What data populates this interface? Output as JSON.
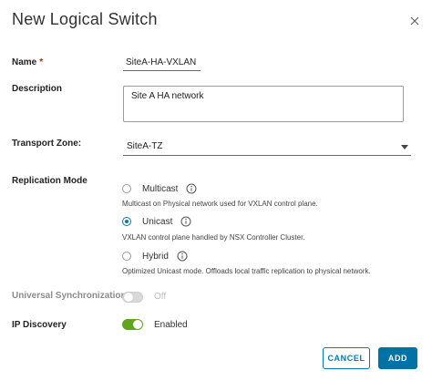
{
  "dialog": {
    "title": "New Logical Switch"
  },
  "fields": {
    "name": {
      "label": "Name",
      "required_mark": "*",
      "value": "SiteA-HA-VXLAN"
    },
    "description": {
      "label": "Description",
      "value": "Site A HA network"
    },
    "transport_zone": {
      "label": "Transport Zone:",
      "selected": "SiteA-TZ"
    },
    "replication_mode": {
      "label": "Replication Mode",
      "selected": "Unicast",
      "options": [
        {
          "label": "Multicast",
          "description": "Multicast on Physical network used for VXLAN control plane."
        },
        {
          "label": "Unicast",
          "description": "VXLAN control plane handled by NSX Controller Cluster."
        },
        {
          "label": "Hybrid",
          "description": "Optimized Unicast mode. Offloads local traffic replication to physical network."
        }
      ]
    },
    "universal_sync": {
      "label": "Universal Synchronization:",
      "state": "Off"
    },
    "ip_discovery": {
      "label": "IP Discovery",
      "state": "Enabled"
    }
  },
  "buttons": {
    "cancel": "CANCEL",
    "add": "ADD"
  },
  "colors": {
    "accent": "#0079b8",
    "primary_button": "#0072a3",
    "toggle_on": "#62a420",
    "required": "#c92100"
  },
  "icons": {
    "close": "close-icon",
    "info": "info-icon",
    "dropdown": "caret-icon"
  }
}
